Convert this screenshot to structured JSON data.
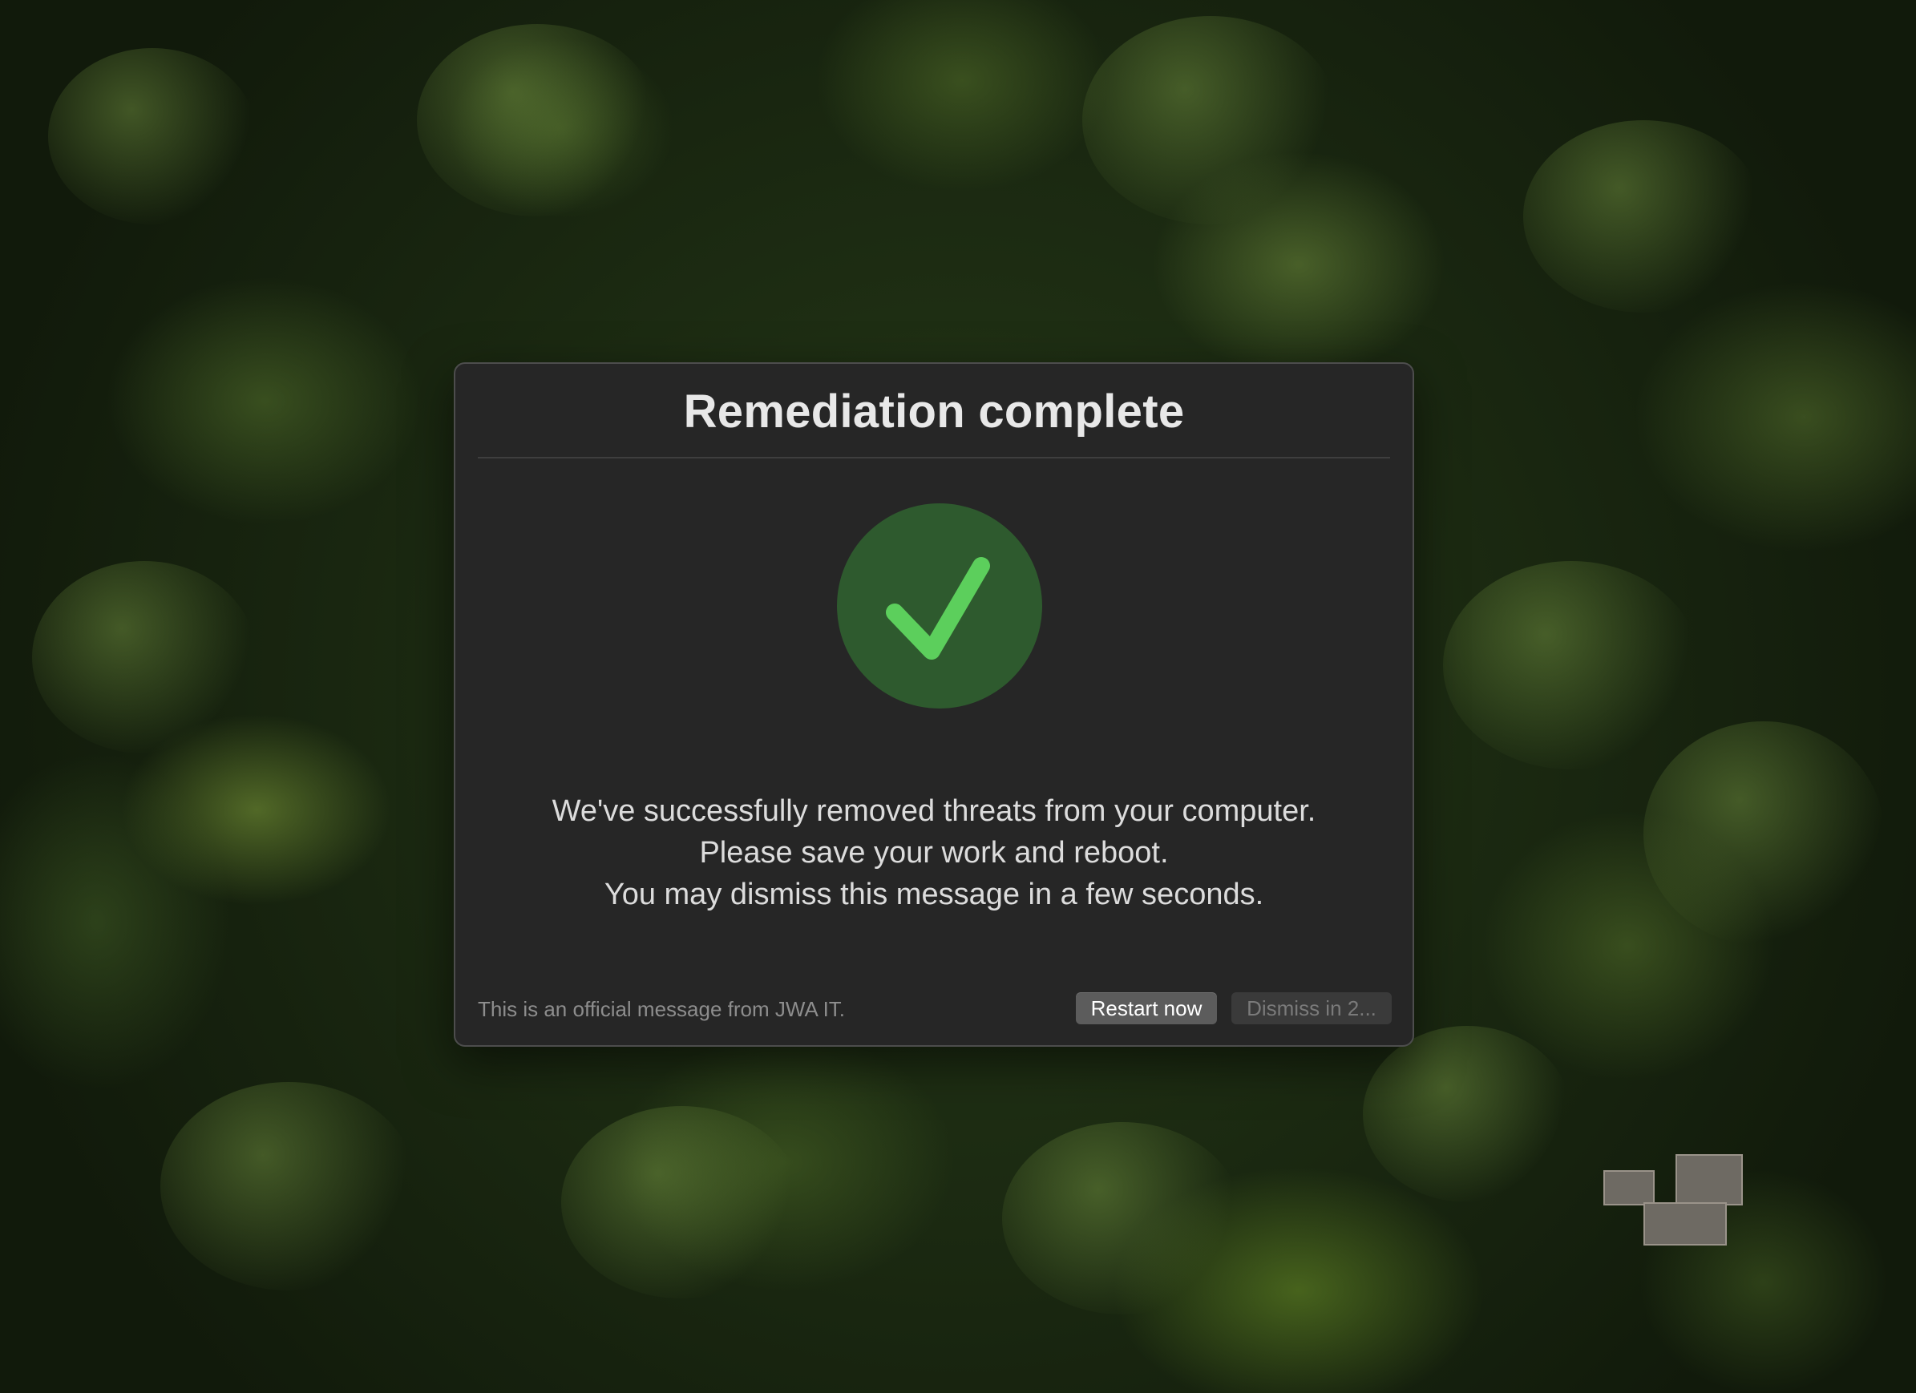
{
  "dialog": {
    "title": "Remediation complete",
    "status_icon": "checkmark-icon",
    "message_lines": [
      "We've successfully removed threats from your computer.",
      "Please save your work and reboot.",
      "You may dismiss this message in a few seconds."
    ],
    "footer_note": "This is an official message from JWA IT.",
    "buttons": {
      "restart_label": "Restart now",
      "dismiss_label": "Dismiss in 2..."
    }
  },
  "colors": {
    "dialog_background": "#262626",
    "badge_background": "#2e5a2e",
    "checkmark": "#5ccf5c",
    "primary_button": "#5c5c5c",
    "disabled_button": "#3a3a3a"
  }
}
